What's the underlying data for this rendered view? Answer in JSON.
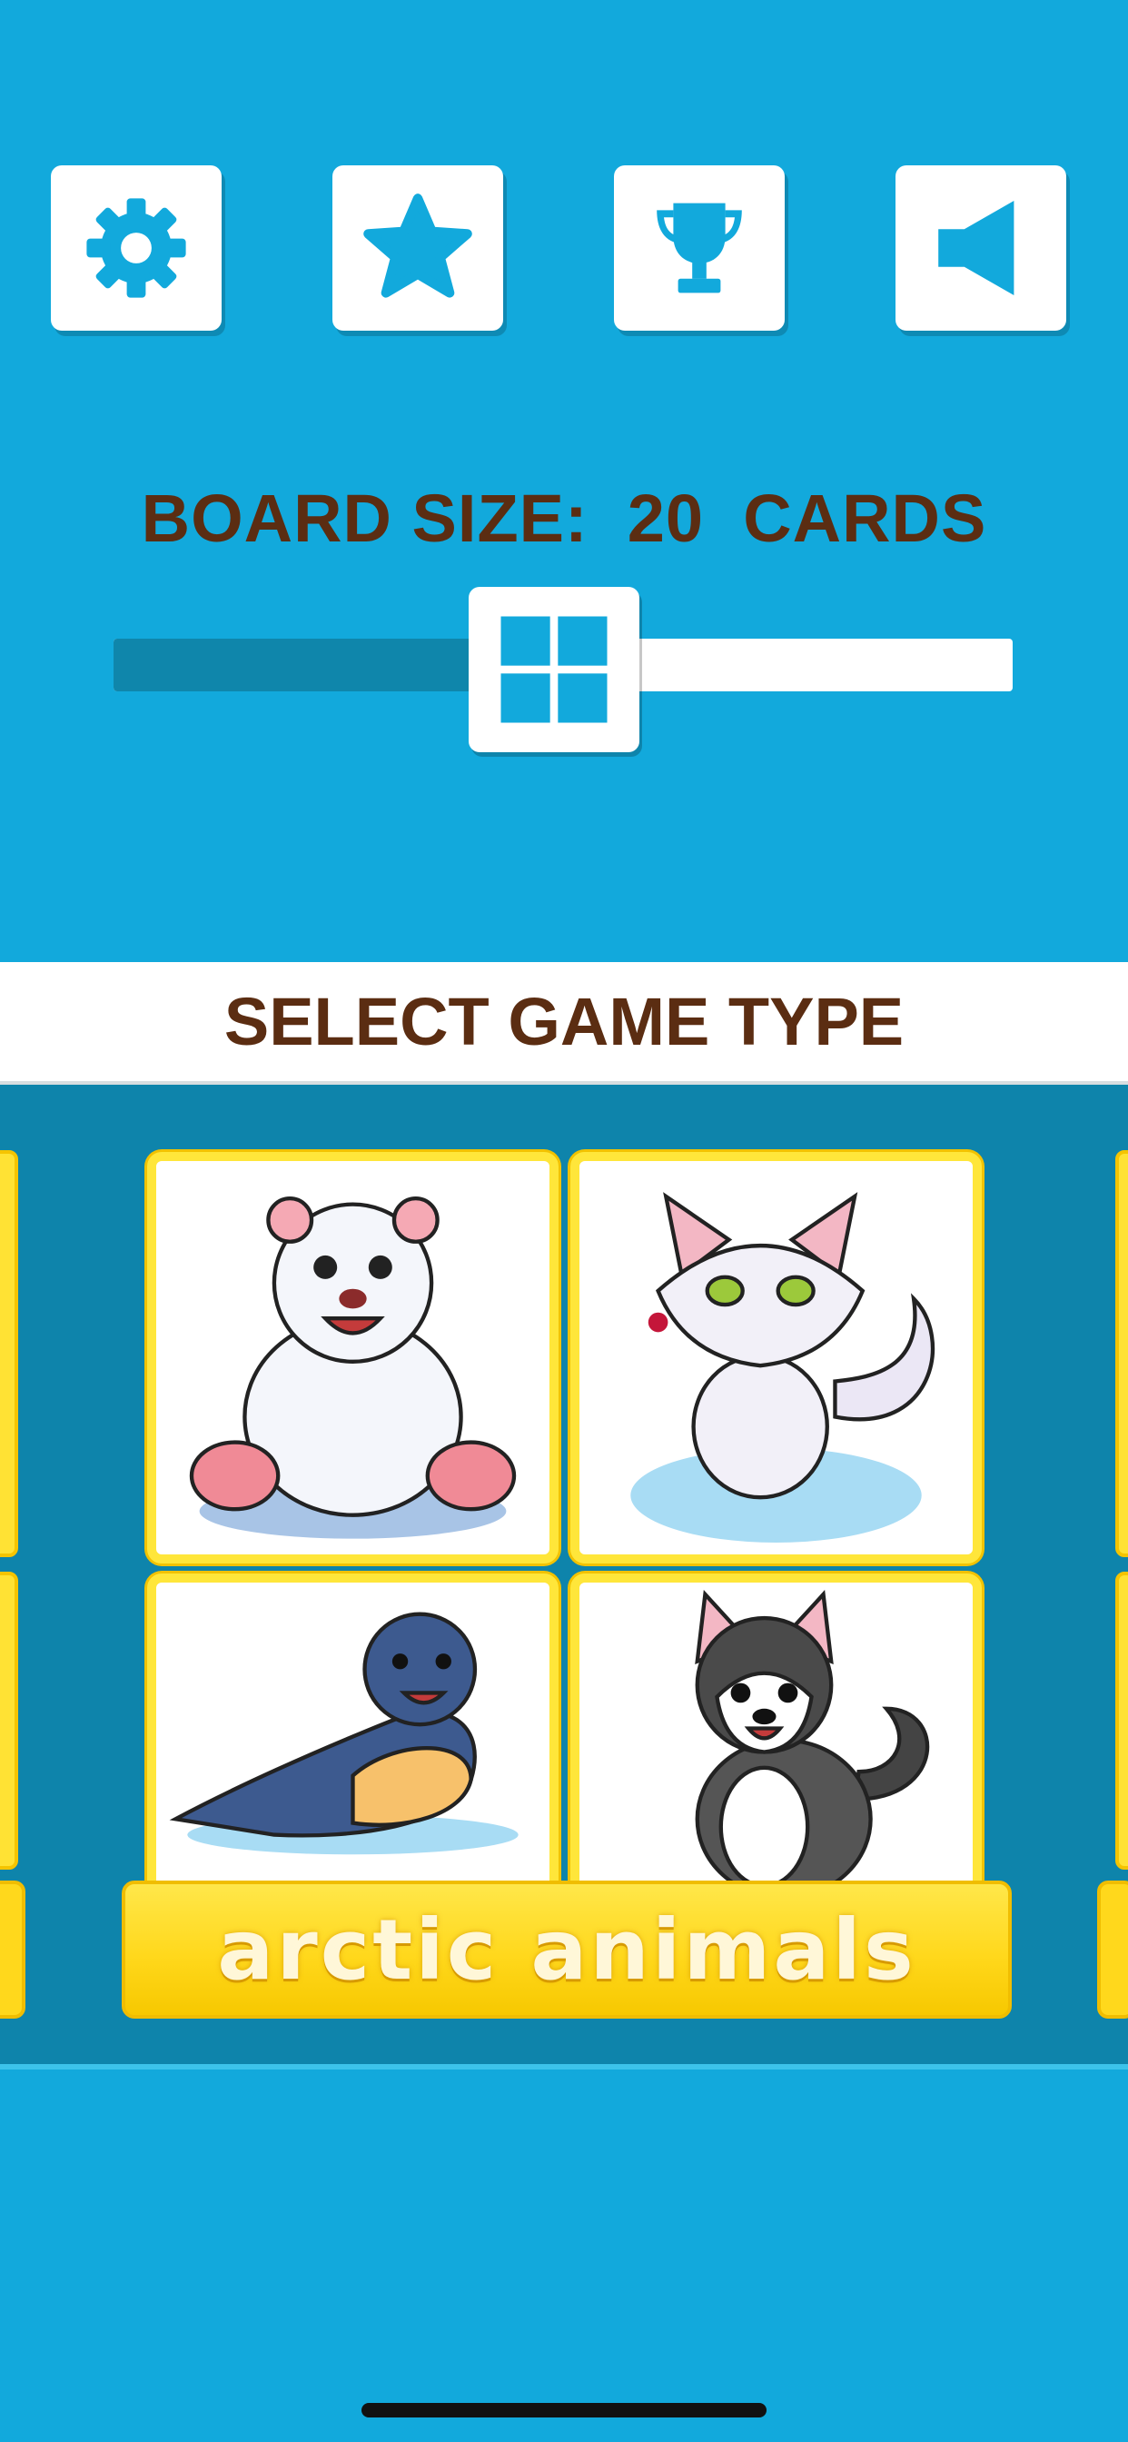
{
  "toolbar": {
    "buttons": [
      {
        "name": "settings",
        "icon": "gear-icon"
      },
      {
        "name": "favorites",
        "icon": "star-icon"
      },
      {
        "name": "achievements",
        "icon": "trophy-icon"
      },
      {
        "name": "sound",
        "icon": "speaker-icon"
      }
    ]
  },
  "board": {
    "title": "BOARD SIZE:  20  CARDS",
    "slider_value_fraction": 0.49,
    "thumb_icon": "grid-icon"
  },
  "game_type": {
    "header": "SELECT GAME TYPE",
    "selected_label": "arctic animals",
    "cards": [
      {
        "name": "polar-bear",
        "icon": "polar-bear-icon"
      },
      {
        "name": "arctic-fox",
        "icon": "arctic-fox-icon"
      },
      {
        "name": "seal",
        "icon": "seal-icon"
      },
      {
        "name": "husky",
        "icon": "husky-icon"
      }
    ]
  },
  "colors": {
    "background": "#12a9dc",
    "accent_dark": "#0e84ab",
    "title_brown": "#5b2d12",
    "card_yellow": "#ffe63a"
  }
}
